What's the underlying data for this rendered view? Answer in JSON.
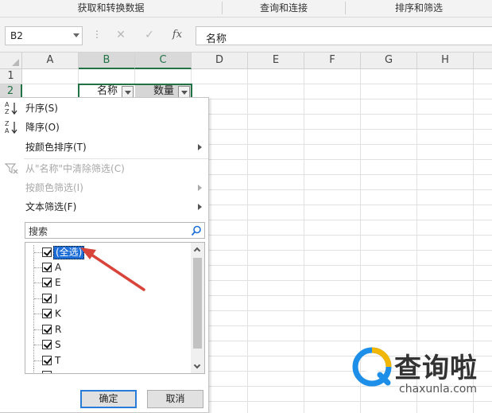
{
  "ribbon": {
    "groups": [
      "获取和转换数据",
      "查询和连接",
      "排序和筛选"
    ]
  },
  "formula_bar": {
    "name_box": "B2",
    "dots": "⋮",
    "cancel_icon": "✕",
    "enter_icon": "✓",
    "fx_label": "fx",
    "value": "名称"
  },
  "grid": {
    "columns": [
      "A",
      "B",
      "C",
      "D",
      "E",
      "F",
      "G",
      "H"
    ],
    "rows": [
      "1",
      "2"
    ],
    "cells": {
      "b2": "名称",
      "c2": "数量"
    }
  },
  "menu": {
    "sort_asc": "升序(S)",
    "sort_desc": "降序(O)",
    "sort_by_color": "按颜色排序(T)",
    "clear_filter": "从\"名称\"中清除筛选(C)",
    "filter_by_color": "按颜色筛选(I)",
    "text_filter": "文本筛选(F)",
    "search_placeholder": "搜索",
    "items": [
      {
        "label": "(全选)",
        "checked": true
      },
      {
        "label": "A",
        "checked": true
      },
      {
        "label": "E",
        "checked": true
      },
      {
        "label": "J",
        "checked": true
      },
      {
        "label": "K",
        "checked": true
      },
      {
        "label": "R",
        "checked": true
      },
      {
        "label": "S",
        "checked": true
      },
      {
        "label": "T",
        "checked": true
      },
      {
        "label": "",
        "checked": true
      }
    ],
    "ok": "确定",
    "cancel": "取消"
  },
  "icons": {
    "sort_asc": "sort-az-icon",
    "sort_desc": "sort-za-icon",
    "clear_filter": "clear-filter-icon",
    "search": "search-icon"
  },
  "colors": {
    "accent_green": "#217346",
    "selection_blue": "#1e6ed8",
    "annotation_red": "#d9443a"
  },
  "watermark": {
    "title": "查询啦",
    "url": "chaxunla.com"
  }
}
